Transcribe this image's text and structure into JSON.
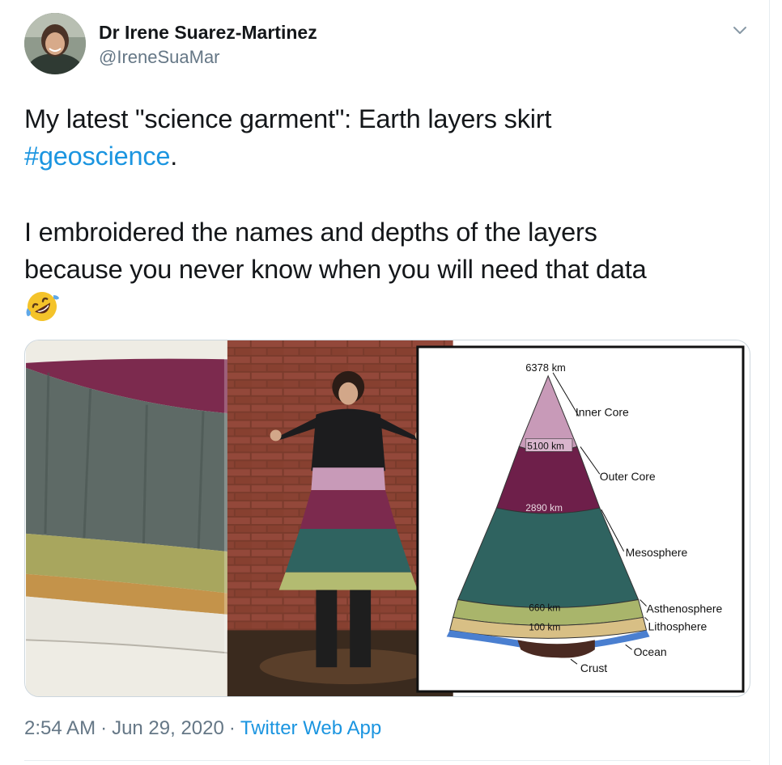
{
  "author": {
    "display_name": "Dr Irene Suarez-Martinez",
    "handle": "@IreneSuaMar"
  },
  "tweet": {
    "line1": "My latest \"science garment\": Earth layers skirt",
    "hashtag": "#geoscience",
    "hashtag_suffix": ".",
    "line3": "I embroidered the names and depths of the layers",
    "line4": "because you never know when you will need that data",
    "emoji": "rolling-on-the-floor-laughing"
  },
  "diagram": {
    "top_depth": "6378 km",
    "inner_core": "Inner Core",
    "depth_5100": "5100 km",
    "outer_core": "Outer Core",
    "depth_2890": "2890 km",
    "mesosphere": "Mesosphere",
    "depth_660": "660 km",
    "depth_100": "100 km",
    "asthenosphere": "Asthenosphere",
    "lithosphere": "Lithosphere",
    "ocean": "Ocean",
    "crust": "Crust"
  },
  "meta": {
    "time": "2:54 AM",
    "separator": "·",
    "date": "Jun 29, 2020",
    "source": "Twitter Web App"
  },
  "colors": {
    "link": "#1b95e0",
    "secondary_text": "#657786",
    "inner_core": "#c89ab8",
    "outer_core": "#6e1f4a",
    "mesosphere": "#2f6360",
    "asthenosphere": "#a9b56b",
    "lithosphere": "#d8bf85",
    "ocean": "#4a7fd0",
    "crust": "#4a2a22"
  }
}
